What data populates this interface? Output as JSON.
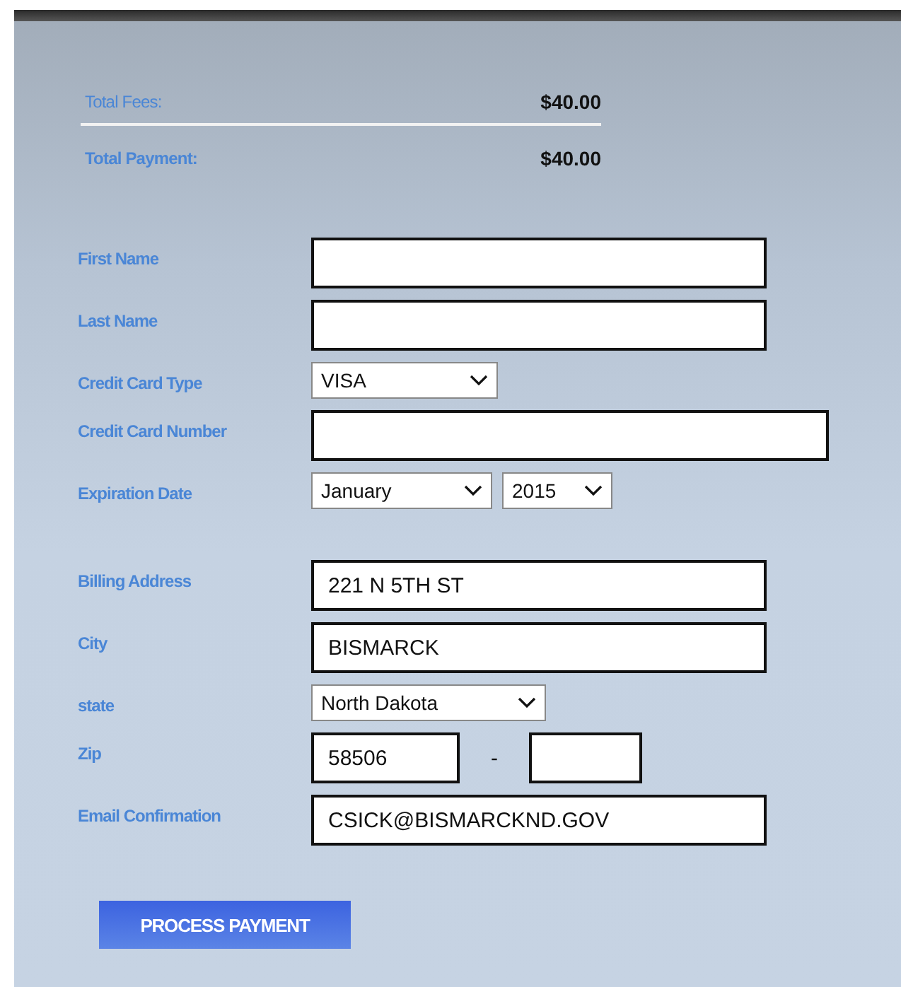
{
  "totals": [
    {
      "label": "Total Fees:",
      "amount": "$40.00",
      "bold": false
    },
    {
      "label": "Total Payment:",
      "amount": "$40.00",
      "bold": true
    }
  ],
  "card_section": [
    {
      "kind": "text",
      "label": "First Name"
    },
    {
      "kind": "text",
      "label": "Last Name"
    },
    {
      "kind": "select",
      "label": "Credit Card Type",
      "options": [
        "VISA"
      ]
    },
    {
      "kind": "wide_text",
      "label": "Credit Card Number"
    },
    {
      "kind": "select",
      "label": "Expiration Date",
      "options": [
        "January",
        "2015"
      ]
    }
  ],
  "billing_section": [
    {
      "kind": "text",
      "label": "Billing Address",
      "value": "221 N 5TH ST"
    },
    {
      "kind": "text",
      "label": "City",
      "value": "BISMARCK"
    },
    {
      "kind": "select",
      "label": "state",
      "options": [
        "North Dakota"
      ]
    },
    {
      "kind": "zip",
      "label": "Zip",
      "value": "58506",
      "separator": "-"
    },
    {
      "kind": "text",
      "label": "Email Confirmation",
      "value": "CSICK@BISMARCKND.GOV"
    }
  ],
  "submit": {
    "label": "PROCESS PAYMENT"
  }
}
